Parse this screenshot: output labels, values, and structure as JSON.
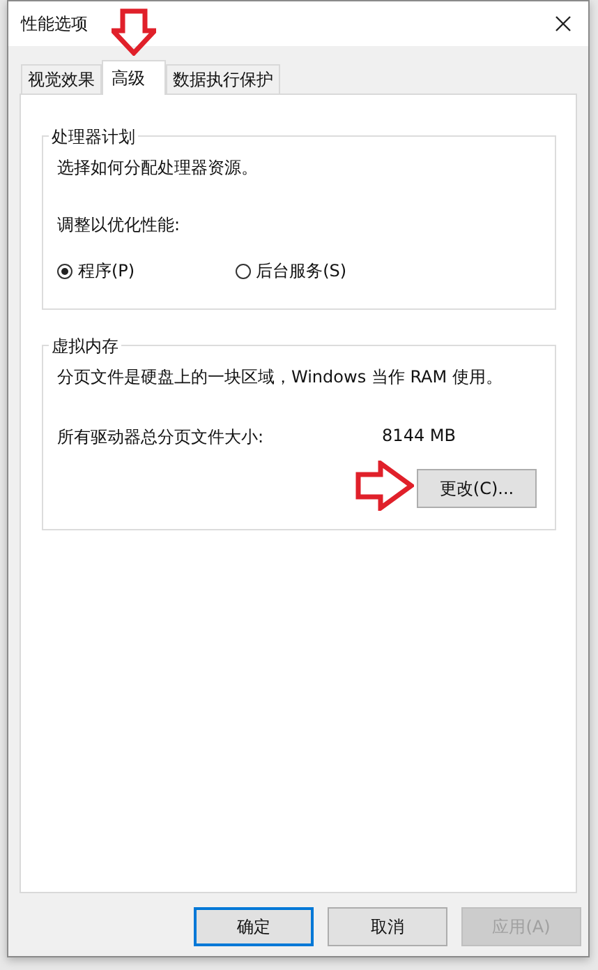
{
  "window": {
    "title": "性能选项"
  },
  "tabs": [
    {
      "label": "视觉效果",
      "selected": false
    },
    {
      "label": "高级",
      "selected": true
    },
    {
      "label": "数据执行保护",
      "selected": false
    }
  ],
  "processor_scheduling": {
    "title": "处理器计划",
    "description": "选择如何分配处理器资源。",
    "prompt": "调整以优化性能:",
    "options": [
      {
        "label": "程序(P)",
        "selected": true
      },
      {
        "label": "后台服务(S)",
        "selected": false
      }
    ]
  },
  "virtual_memory": {
    "title": "虚拟内存",
    "description": "分页文件是硬盘上的一块区域，Windows 当作 RAM 使用。",
    "total_label": "所有驱动器总分页文件大小:",
    "total_value": "8144 MB",
    "change_button": "更改(C)..."
  },
  "buttons": [
    {
      "label": "确定",
      "kind": "default",
      "disabled": false
    },
    {
      "label": "取消",
      "kind": "normal",
      "disabled": false
    },
    {
      "label": "应用(A)",
      "kind": "normal",
      "disabled": true
    }
  ]
}
